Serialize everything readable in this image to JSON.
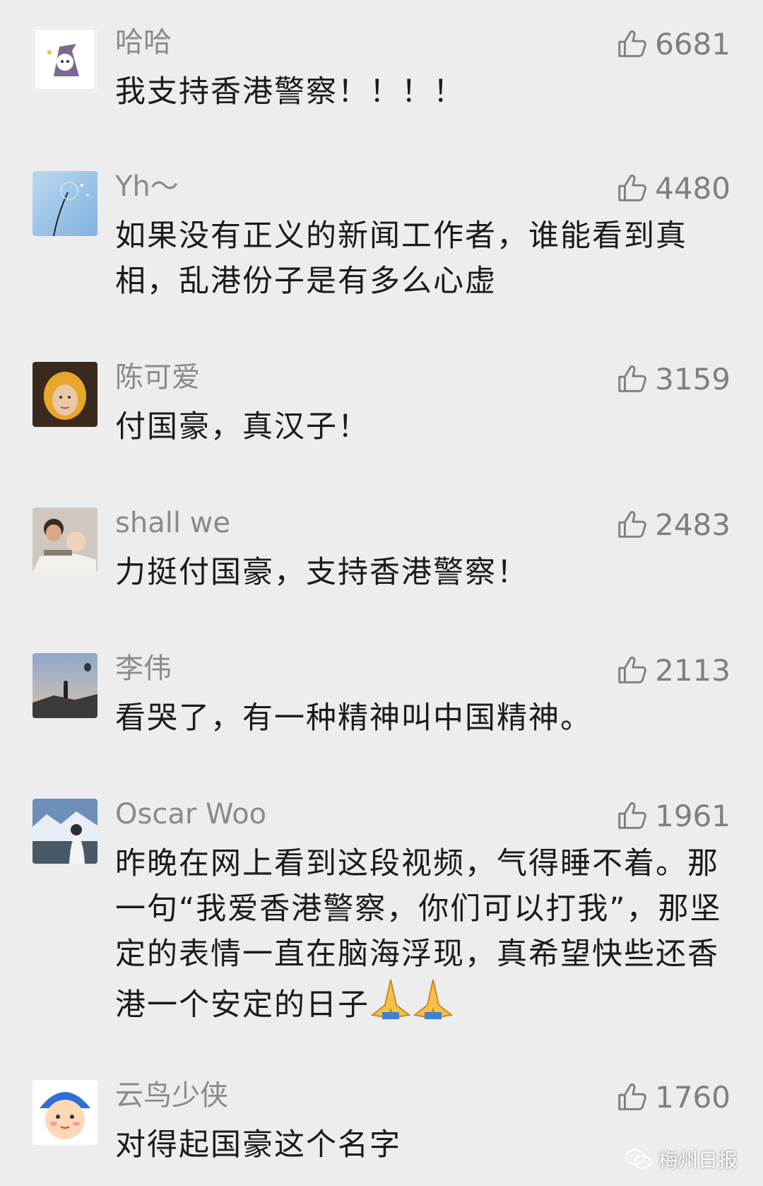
{
  "comments": [
    {
      "name": "哈哈",
      "likes": "6681",
      "text": "我支持香港警察！！！！"
    },
    {
      "name": "Yh～",
      "likes": "4480",
      "text": "如果没有正义的新闻工作者，谁能看到真相，乱港份子是有多么心虚"
    },
    {
      "name": "陈可爱",
      "likes": "3159",
      "text": "付国豪，真汉子！"
    },
    {
      "name": "shall we",
      "likes": "2483",
      "text": "力挺付国豪，支持香港警察！"
    },
    {
      "name": "李伟",
      "likes": "2113",
      "text": "看哭了，有一种精神叫中国精神。"
    },
    {
      "name": "Oscar Woo",
      "likes": "1961",
      "text": "昨晚在网上看到这段视频，气得睡不着。那一句“我爱香港警察，你们可以打我”，那坚定的表情一直在脑海浮现，真希望快些还香港一个安定的日子"
    },
    {
      "name": "云鸟少侠",
      "likes": "1760",
      "text": "对得起国豪这个名字"
    }
  ],
  "icons": {
    "like": "thumbs-up-icon",
    "emoji": "folded-hands-emoji",
    "watermark": "wechat-icon"
  },
  "watermark": {
    "text": "梅州日报"
  },
  "colors": {
    "background": "#ededed",
    "name": "#8a8a8a",
    "text": "#1a1a1a",
    "likes": "#7f7f7f"
  }
}
